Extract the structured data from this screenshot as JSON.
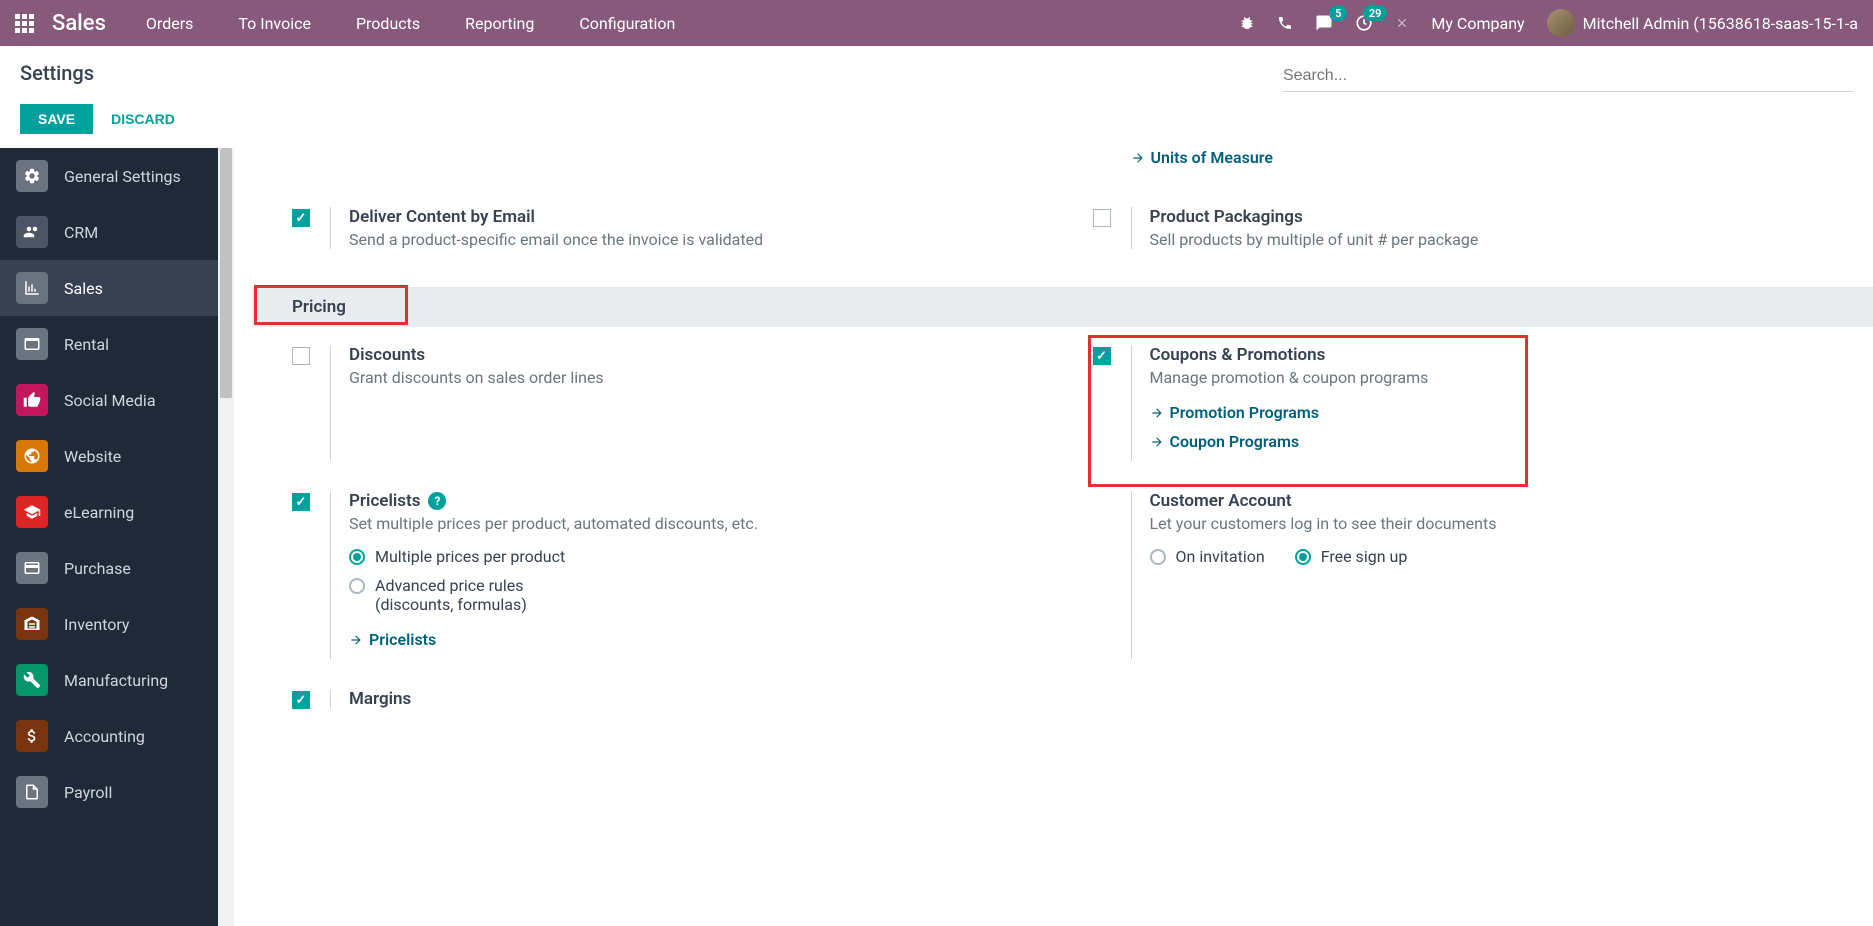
{
  "navbar": {
    "app": "Sales",
    "menu": [
      "Orders",
      "To Invoice",
      "Products",
      "Reporting",
      "Configuration"
    ],
    "msg_badge": "5",
    "clock_badge": "29",
    "company": "My Company",
    "user": "Mitchell Admin (15638618-saas-15-1-a"
  },
  "header": {
    "title": "Settings",
    "search_placeholder": "Search...",
    "save": "SAVE",
    "discard": "DISCARD"
  },
  "sidebar": [
    {
      "label": "General Settings",
      "color": "#6b7280"
    },
    {
      "label": "CRM",
      "color": "#4b5563"
    },
    {
      "label": "Sales",
      "color": "#6b7280"
    },
    {
      "label": "Rental",
      "color": "#6b7280"
    },
    {
      "label": "Social Media",
      "color": "#c2185b"
    },
    {
      "label": "Website",
      "color": "#d97706"
    },
    {
      "label": "eLearning",
      "color": "#dc2626"
    },
    {
      "label": "Purchase",
      "color": "#6b7280"
    },
    {
      "label": "Inventory",
      "color": "#78350f"
    },
    {
      "label": "Manufacturing",
      "color": "#059669"
    },
    {
      "label": "Accounting",
      "color": "#78350f"
    },
    {
      "label": "Payroll",
      "color": "#6b7280"
    }
  ],
  "settings": {
    "top_link": "Units of Measure",
    "deliver": {
      "title": "Deliver Content by Email",
      "desc": "Send a product-specific email once the invoice is validated"
    },
    "packaging": {
      "title": "Product Packagings",
      "desc": "Sell products by multiple of unit # per package"
    },
    "section_pricing": "Pricing",
    "discounts": {
      "title": "Discounts",
      "desc": "Grant discounts on sales order lines"
    },
    "coupons": {
      "title": "Coupons & Promotions",
      "desc": "Manage promotion & coupon programs",
      "link1": "Promotion Programs",
      "link2": "Coupon Programs"
    },
    "pricelists": {
      "title": "Pricelists",
      "desc": "Set multiple prices per product, automated discounts, etc.",
      "r1": "Multiple prices per product",
      "r2a": "Advanced price rules",
      "r2b": "(discounts, formulas)",
      "link": "Pricelists"
    },
    "customer": {
      "title": "Customer Account",
      "desc": "Let your customers log in to see their documents",
      "r1": "On invitation",
      "r2": "Free sign up"
    },
    "margins": {
      "title": "Margins"
    }
  }
}
